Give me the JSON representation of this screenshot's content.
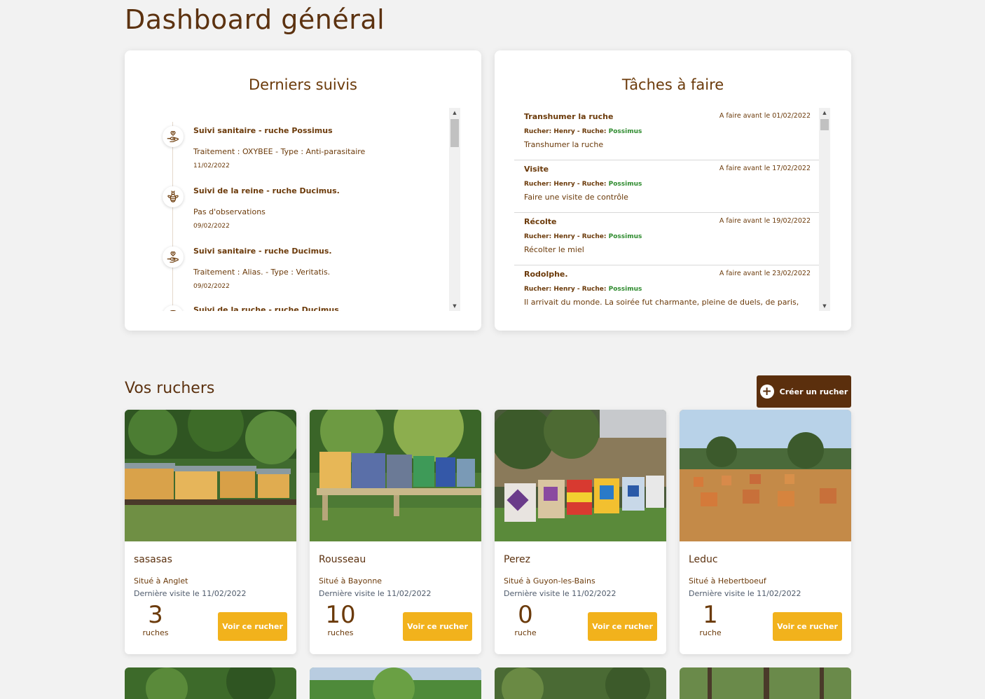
{
  "page": {
    "title": "Dashboard général"
  },
  "suivis": {
    "title": "Derniers suivis",
    "items": [
      {
        "icon": "hand-heart-icon",
        "title": "Suivi sanitaire - ruche Possimus",
        "desc": "Traitement : OXYBEE - Type : Anti-parasitaire",
        "date": "11/02/2022"
      },
      {
        "icon": "bee-icon",
        "title": "Suivi de la reine - ruche Ducimus.",
        "desc": "Pas d'observations",
        "date": "09/02/2022"
      },
      {
        "icon": "hand-heart-icon",
        "title": "Suivi sanitaire - ruche Ducimus.",
        "desc": "Traitement : Alias. - Type : Veritatis.",
        "date": "09/02/2022"
      },
      {
        "icon": "hive-icon",
        "title": "Suivi de la ruche - ruche Ducimus.",
        "desc": "",
        "date": ""
      }
    ]
  },
  "taches": {
    "title": "Tâches à faire",
    "items": [
      {
        "name": "Transhumer la ruche",
        "due": "A faire avant le 01/02/2022",
        "meta": "Rucher: Henry - Ruche:",
        "hive": "Possimus",
        "desc": "Transhumer la ruche"
      },
      {
        "name": "Visite",
        "due": "A faire avant le 17/02/2022",
        "meta": "Rucher: Henry - Ruche:",
        "hive": "Possimus",
        "desc": "Faire une visite de contrôle"
      },
      {
        "name": "Récolte",
        "due": "A faire avant le 19/02/2022",
        "meta": "Rucher: Henry - Ruche:",
        "hive": "Possimus",
        "desc": "Récolter le miel"
      },
      {
        "name": "Rodolphe.",
        "due": "A faire avant le 23/02/2022",
        "meta": "Rucher: Henry - Ruche:",
        "hive": "Possimus",
        "desc": "Il arrivait du monde. La soirée fut charmante, pleine de duels, de paris,"
      }
    ]
  },
  "ruchers": {
    "title": "Vos ruchers",
    "create_label": "Créer un rucher",
    "cards": [
      {
        "name": "sasasas",
        "location": "Situé à Anglet",
        "visit": "Dernière visite le 11/02/2022",
        "count": "3",
        "unit": "ruches",
        "button": "Voir ce rucher"
      },
      {
        "name": "Rousseau",
        "location": "Situé à Bayonne",
        "visit": "Dernière visite le 11/02/2022",
        "count": "10",
        "unit": "ruches",
        "button": "Voir ce rucher"
      },
      {
        "name": "Perez",
        "location": "Situé à Guyon-les-Bains",
        "visit": "Dernière visite le 11/02/2022",
        "count": "0",
        "unit": "ruche",
        "button": "Voir ce rucher"
      },
      {
        "name": "Leduc",
        "location": "Situé à Hebertboeuf",
        "visit": "Dernière visite le 11/02/2022",
        "count": "1",
        "unit": "ruche",
        "button": "Voir ce rucher"
      }
    ]
  },
  "colors": {
    "brown": "#5b2f0d",
    "text": "#6b3a0a",
    "yellow": "#f2b21c",
    "green": "#2e8b2e",
    "background": "#f2f2f2"
  }
}
